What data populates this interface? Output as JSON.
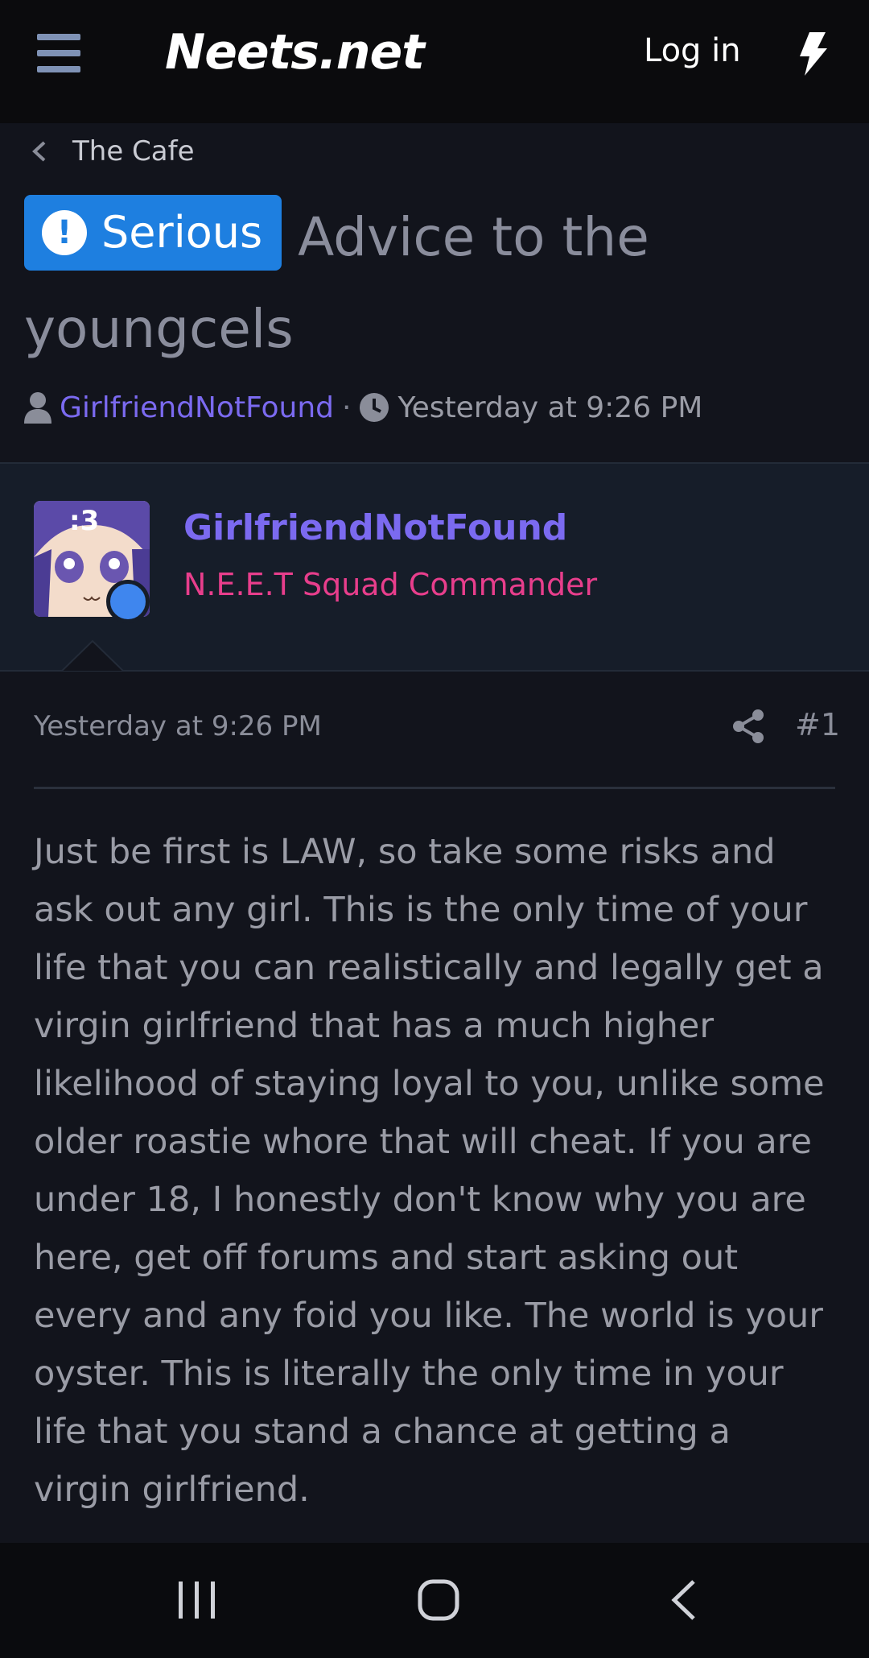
{
  "header": {
    "logo": "Neets.net",
    "login_label": "Log in",
    "icons": [
      "hamburger-menu-icon",
      "bolt-icon"
    ]
  },
  "breadcrumb": {
    "label": "The Cafe"
  },
  "thread": {
    "prefix_label": "Serious",
    "title": "Advice to the youngcels",
    "author": "GirlfriendNotFound",
    "separator": "·",
    "time": "Yesterday at 9:26 PM"
  },
  "post": {
    "username": "GirlfriendNotFound",
    "user_title": "N.E.E.T Squad Commander",
    "avatar_text": ":3",
    "date": "Yesterday at 9:26 PM",
    "number": "#1",
    "body": "Just be first is LAW, so take some risks and ask out any girl. This is the only time of your life that you can realistically and legally get a virgin girlfriend that has a much higher likelihood of staying loyal to you, unlike some older roastie whore that will cheat. If you are under 18, I honestly don't know why you are here, get off forums and start asking out every and any foid you like. The world is your oyster. This is literally the only time in your life that you stand a chance at getting a virgin girlfriend."
  },
  "colors": {
    "accent_purple": "#7b6af0",
    "badge_blue": "#1e7fe0",
    "user_title_pink": "#e83e8c",
    "online_blue": "#3f86ee"
  }
}
